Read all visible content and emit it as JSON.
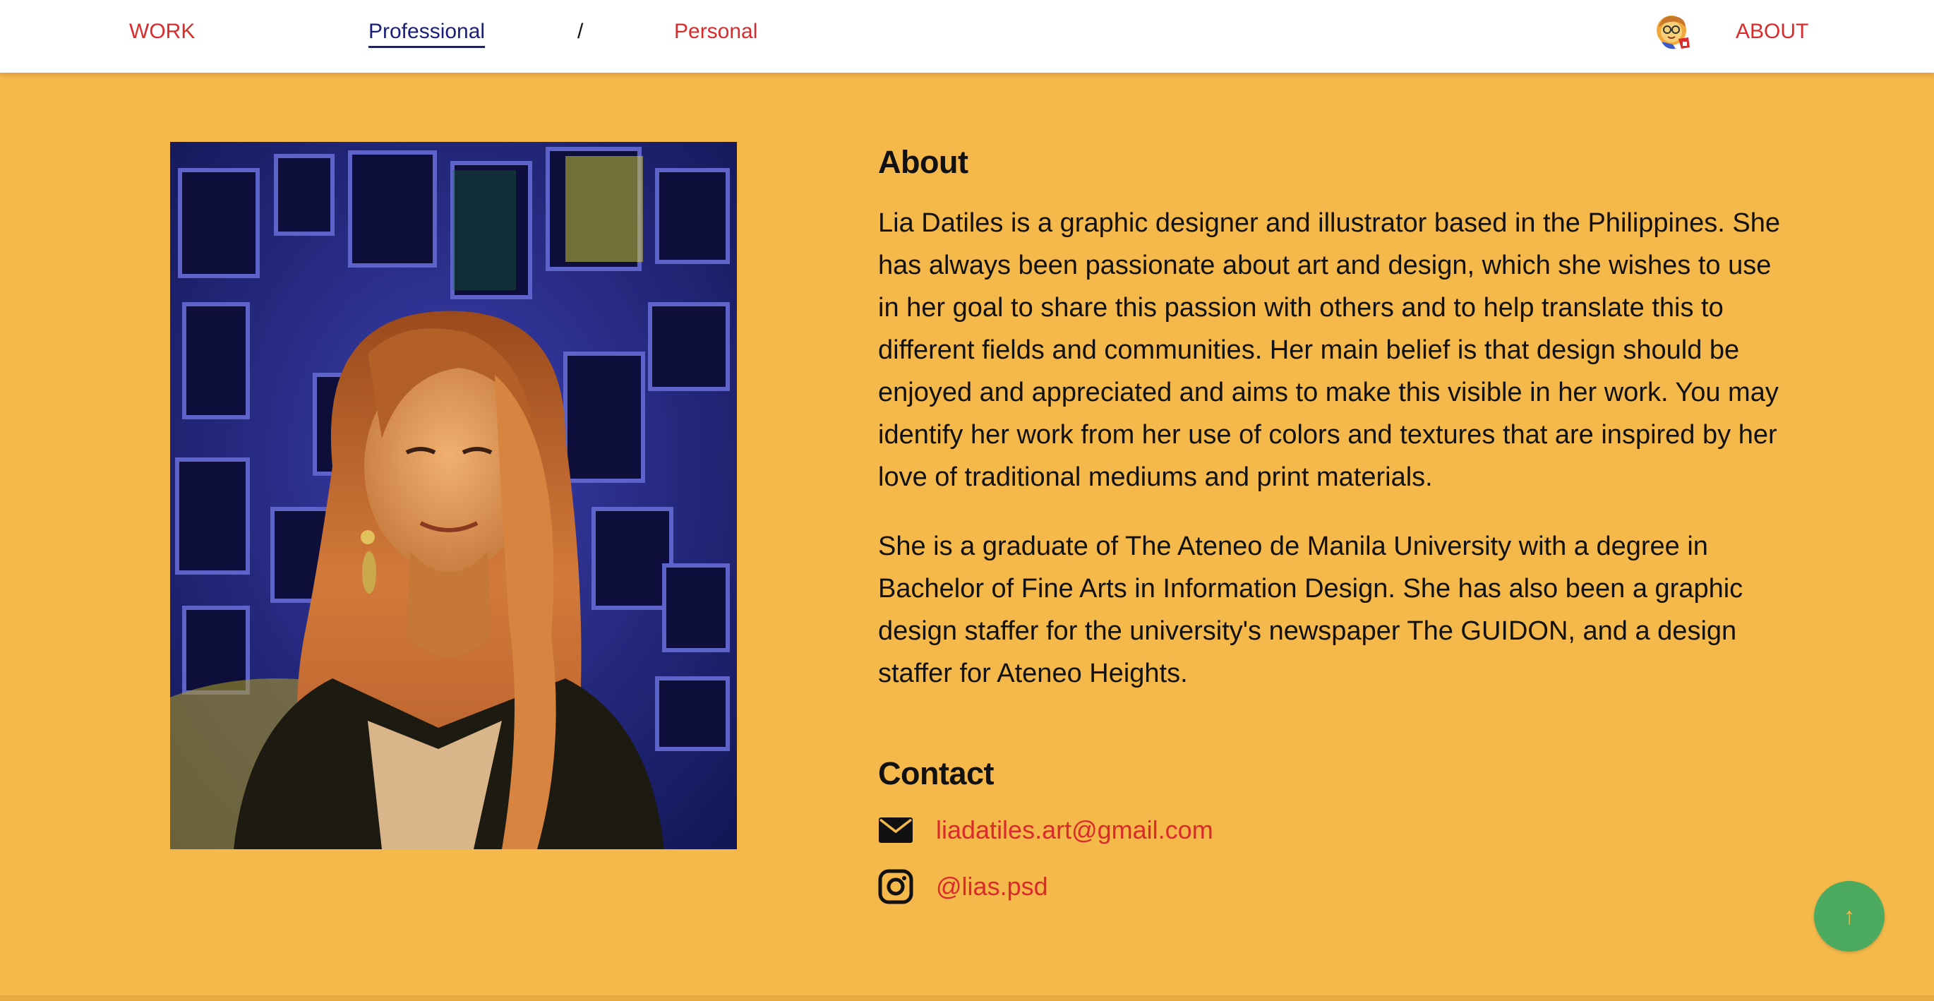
{
  "nav": {
    "work": "WORK",
    "professional": "Professional",
    "separator": "/",
    "personal": "Personal",
    "about": "ABOUT",
    "avatar_icon": "cartoon-avatar-icon"
  },
  "about": {
    "heading": "About",
    "paragraph1": "Lia Datiles is a graphic designer and illustrator based in the Philippines. She has always been passionate about art and design, which she wishes to use in her goal to share this passion with others and to help translate this to different fields and communities. Her main belief is that design should be enjoyed and appreciated and aims to make this visible in her work. You may identify her work from her use of colors and textures that are inspired by her love of traditional mediums and print materials.",
    "paragraph2": "She is a graduate of The Ateneo de Manila University with a degree in Bachelor of Fine Arts in Information Design. She has also been a graphic design staffer for the university's newspaper The GUIDON, and a design staffer for Ateneo Heights."
  },
  "contact": {
    "heading": "Contact",
    "email": "liadatiles.art@gmail.com",
    "email_icon": "envelope-icon",
    "instagram": "@lias.psd",
    "instagram_icon": "instagram-icon"
  },
  "scroll_top": {
    "label": "↑",
    "icon": "arrow-up-icon"
  },
  "colors": {
    "background": "#f5b84a",
    "link": "#d92b2b",
    "active_nav": "#1a1f7a",
    "button": "#4caa5e"
  }
}
